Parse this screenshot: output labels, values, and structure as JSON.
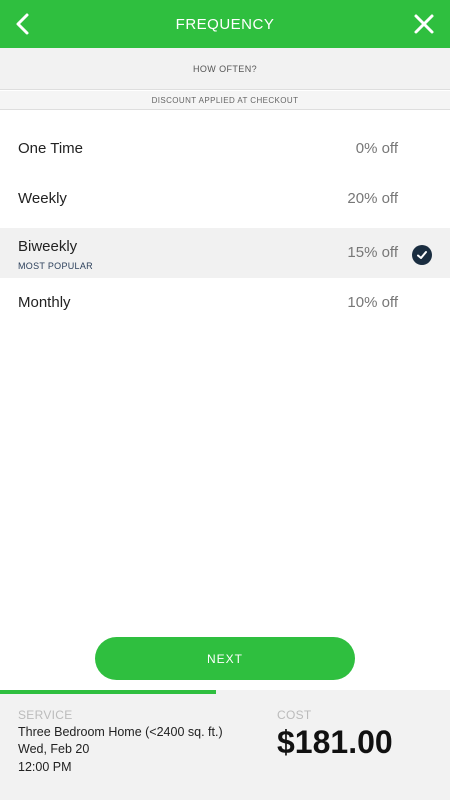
{
  "header": {
    "title": "FREQUENCY",
    "back_icon": "chevron-left-icon",
    "close_icon": "close-icon",
    "color": "#2fbf3f"
  },
  "subheader": {
    "text": "HOW OFTEN?"
  },
  "discount_note": {
    "text": "DISCOUNT APPLIED AT CHECKOUT"
  },
  "options": [
    {
      "name": "One Time",
      "discount": "0% off",
      "selected": false
    },
    {
      "name": "Weekly",
      "discount": "20% off",
      "selected": false
    },
    {
      "name": "Biweekly",
      "discount": "15% off",
      "badge": "MOST POPULAR",
      "selected": true
    },
    {
      "name": "Monthly",
      "discount": "10% off",
      "selected": false
    }
  ],
  "next_button": {
    "label": "NEXT"
  },
  "progress": {
    "fraction": 0.48
  },
  "summary": {
    "service_label": "SERVICE",
    "service_name": "Three Bedroom Home (<2400 sq. ft.)",
    "date": "Wed, Feb 20",
    "time": "12:00 PM",
    "cost_label": "COST",
    "cost": "$181.00"
  }
}
